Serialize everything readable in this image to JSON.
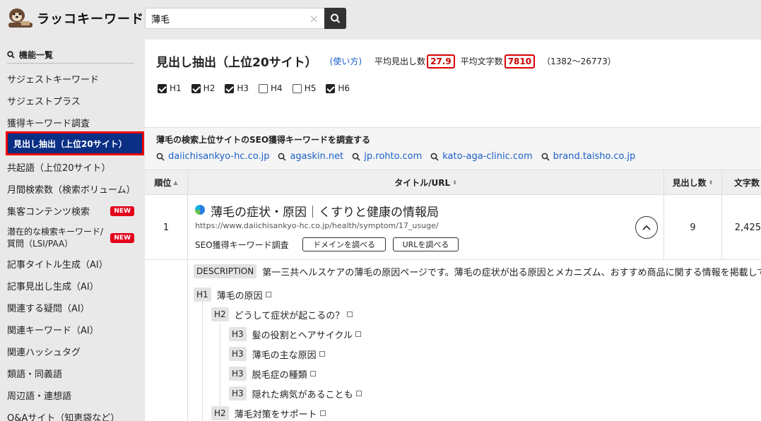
{
  "app": {
    "name": "ラッコキーワード"
  },
  "search": {
    "value": "薄毛",
    "clear": "×"
  },
  "sidebar": {
    "heading": "機能一覧",
    "items": [
      {
        "label": "サジェストキーワード"
      },
      {
        "label": "サジェストプラス"
      },
      {
        "label": "獲得キーワード調査"
      },
      {
        "label": "見出し抽出（上位20サイト）"
      },
      {
        "label": "共起語（上位20サイト）"
      },
      {
        "label": "月間検索数（検索ボリューム）"
      },
      {
        "label": "集客コンテンツ検索",
        "badge": "NEW"
      },
      {
        "label": "潜在的な検索キーワード/",
        "label2": "質問（LSI/PAA）",
        "badge": "NEW"
      },
      {
        "label": "記事タイトル生成（AI）"
      },
      {
        "label": "記事見出し生成（AI）"
      },
      {
        "label": "関連する疑問（AI）"
      },
      {
        "label": "関連キーワード（AI）"
      },
      {
        "label": "関連ハッシュタグ"
      },
      {
        "label": "類語・同義語"
      },
      {
        "label": "周辺語・連想語"
      },
      {
        "label": "Q&Aサイト（知恵袋など）"
      }
    ]
  },
  "main": {
    "title": "見出し抽出（上位20サイト）",
    "howto": "(使い方)",
    "avg_headings_label": "平均見出し数",
    "avg_headings": "27.9",
    "avg_chars_label": "平均文字数",
    "avg_chars": "7810",
    "range": "（1382〜26773）",
    "checks": [
      {
        "label": "H1",
        "checked": true
      },
      {
        "label": "H2",
        "checked": true
      },
      {
        "label": "H3",
        "checked": true
      },
      {
        "label": "H4",
        "checked": false
      },
      {
        "label": "H5",
        "checked": false
      },
      {
        "label": "H6",
        "checked": true
      }
    ],
    "seo_title": "薄毛の検索上位サイトのSEO獲得キーワードを調査する",
    "seo_links": [
      "daiichisankyo-hc.co.jp",
      "agaskin.net",
      "jp.rohto.com",
      "kato-aga-clinic.com",
      "brand.taisho.co.jp"
    ],
    "table": {
      "headers": {
        "rank": "順位",
        "title": "タイトル/URL",
        "count": "見出し数",
        "chars": "文字数"
      },
      "row": {
        "rank": "1",
        "title": "薄毛の症状・原因｜くすりと健康の情報局",
        "url": "https://www.daiichisankyo-hc.co.jp/health/symptom/17_usuge/",
        "seo_label": "SEO獲得キーワード調査",
        "btn_domain": "ドメインを調べる",
        "btn_url": "URLを調べる",
        "count": "9",
        "chars": "2,425"
      }
    },
    "detail": {
      "desc_tag": "DESCRIPTION",
      "description": "第一三共ヘルスケアの薄毛の原因ページです。薄毛の症状が出る原因とメカニズム、おすすめ商品に関する情報を掲載して",
      "headings": [
        {
          "tag": "H1",
          "text": "薄毛の原因"
        },
        {
          "tag": "H2",
          "text": "どうして症状が起こるの？"
        },
        {
          "tag": "H3",
          "text": "髪の役割とヘアサイクル"
        },
        {
          "tag": "H3",
          "text": "薄毛の主な原因"
        },
        {
          "tag": "H3",
          "text": "脱毛症の種類"
        },
        {
          "tag": "H3",
          "text": "隠れた病気があることも"
        },
        {
          "tag": "H2",
          "text": "薄毛対策をサポート"
        }
      ]
    }
  }
}
